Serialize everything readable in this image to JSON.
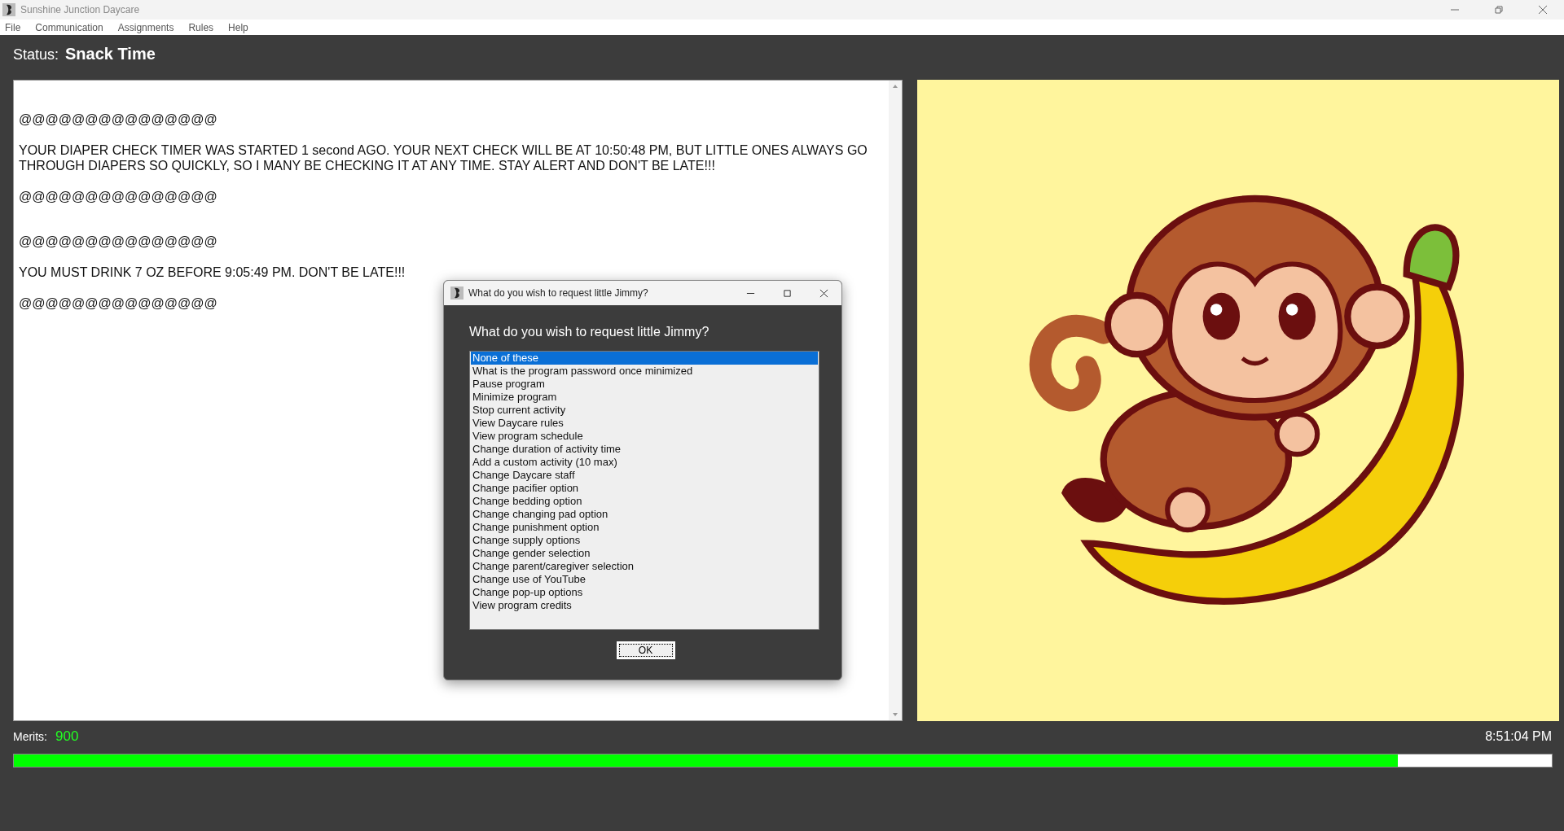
{
  "window": {
    "title": "Sunshine Junction Daycare"
  },
  "menu": [
    "File",
    "Communication",
    "Assignments",
    "Rules",
    "Help"
  ],
  "status": {
    "label": "Status:",
    "value": "Snack Time"
  },
  "log": [
    {
      "kind": "rule",
      "text": "@@@@@@@@@@@@@@@"
    },
    {
      "kind": "message",
      "text": "YOUR DIAPER CHECK TIMER WAS STARTED 1 second AGO. YOUR NEXT CHECK WILL BE AT 10:50:48 PM, BUT LITTLE ONES ALWAYS GO THROUGH DIAPERS SO QUICKLY, SO I MANY BE CHECKING IT AT ANY TIME. STAY ALERT AND DON'T BE LATE!!!"
    },
    {
      "kind": "rule",
      "text": "@@@@@@@@@@@@@@@"
    },
    {
      "kind": "gap"
    },
    {
      "kind": "rule",
      "text": "@@@@@@@@@@@@@@@"
    },
    {
      "kind": "message",
      "text": "YOU MUST DRINK 7 OZ BEFORE 9:05:49 PM. DON'T BE LATE!!!"
    },
    {
      "kind": "rule",
      "text": "@@@@@@@@@@@@@@@"
    }
  ],
  "dialog": {
    "title": "What do you wish to request little Jimmy?",
    "prompt": "What do you wish to request little Jimmy?",
    "options": [
      {
        "label": "None of these",
        "selected": true
      },
      {
        "label": "What is the program password once minimized",
        "selected": false
      },
      {
        "label": "Pause program",
        "selected": false
      },
      {
        "label": "Minimize program",
        "selected": false
      },
      {
        "label": "Stop current activity",
        "selected": false
      },
      {
        "label": "View Daycare rules",
        "selected": false
      },
      {
        "label": "View program schedule",
        "selected": false
      },
      {
        "label": "Change duration of activity time",
        "selected": false
      },
      {
        "label": "Add a custom activity (10 max)",
        "selected": false
      },
      {
        "label": "Change Daycare staff",
        "selected": false
      },
      {
        "label": "Change pacifier option",
        "selected": false
      },
      {
        "label": "Change bedding option",
        "selected": false
      },
      {
        "label": "Change changing pad option",
        "selected": false
      },
      {
        "label": "Change punishment option",
        "selected": false
      },
      {
        "label": "Change supply options",
        "selected": false
      },
      {
        "label": "Change gender selection",
        "selected": false
      },
      {
        "label": "Change parent/caregiver selection",
        "selected": false
      },
      {
        "label": "Change use of YouTube",
        "selected": false
      },
      {
        "label": "Change pop-up options",
        "selected": false
      },
      {
        "label": "View program credits",
        "selected": false
      }
    ],
    "ok_button": "OK"
  },
  "merits": {
    "label": "Merits:",
    "value": "900"
  },
  "clock": "8:51:04 PM",
  "progress": {
    "level": 0.9
  }
}
